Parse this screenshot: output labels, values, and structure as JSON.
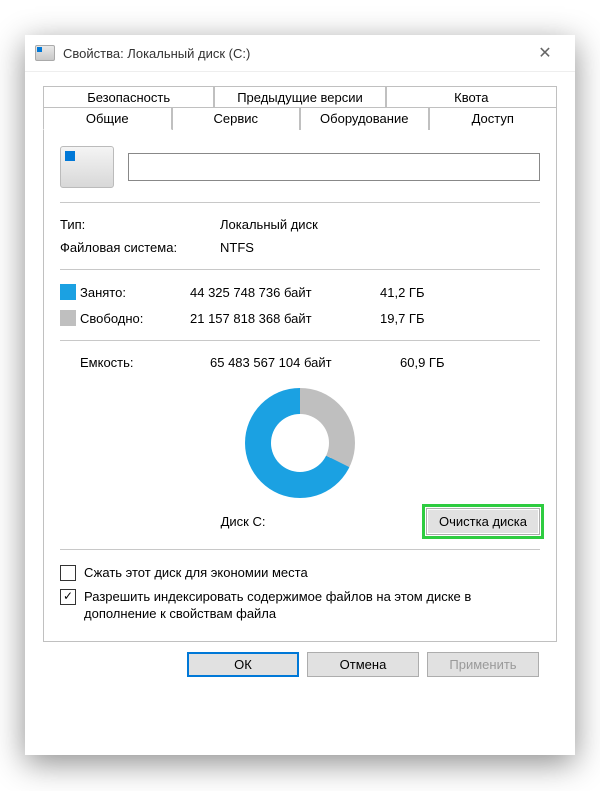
{
  "window": {
    "title": "Свойства: Локальный диск (C:)"
  },
  "tabs": {
    "row1": [
      "Безопасность",
      "Предыдущие версии",
      "Квота"
    ],
    "row2": [
      "Общие",
      "Сервис",
      "Оборудование",
      "Доступ"
    ],
    "active": "Общие"
  },
  "general": {
    "name_value": "",
    "type_label": "Тип:",
    "type_value": "Локальный диск",
    "fs_label": "Файловая система:",
    "fs_value": "NTFS",
    "used_label": "Занято:",
    "used_bytes": "44 325 748 736 байт",
    "used_gb": "41,2 ГБ",
    "free_label": "Свободно:",
    "free_bytes": "21 157 818 368 байт",
    "free_gb": "19,7 ГБ",
    "cap_label": "Емкость:",
    "cap_bytes": "65 483 567 104 байт",
    "cap_gb": "60,9 ГБ",
    "disk_label": "Диск C:",
    "cleanup_button": "Очистка диска",
    "compress_label": "Сжать этот диск для экономии места",
    "index_label": "Разрешить индексировать содержимое файлов на этом диске в дополнение к свойствам файла",
    "compress_checked": false,
    "index_checked": true
  },
  "buttons": {
    "ok": "ОК",
    "cancel": "Отмена",
    "apply": "Применить"
  },
  "chart_data": {
    "type": "pie",
    "title": "Диск C:",
    "series": [
      {
        "name": "Занято",
        "value": 44325748736,
        "color": "#1ba1e2"
      },
      {
        "name": "Свободно",
        "value": 21157818368,
        "color": "#bfbfbf"
      }
    ],
    "total": 65483567104
  }
}
